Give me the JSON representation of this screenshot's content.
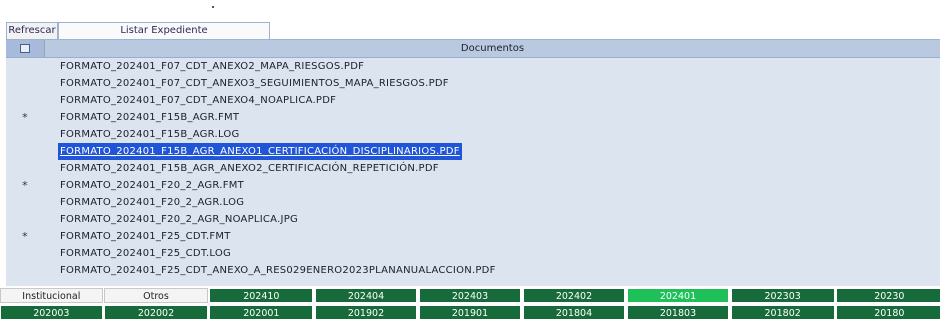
{
  "toolbar": {
    "refresh_label": "Refrescar",
    "list_label": "Listar Expediente"
  },
  "grid": {
    "header_title": "Documentos",
    "rows": [
      {
        "mark": "",
        "name": "FORMATO_202401_F07_CDT_ANEXO2_MAPA_RIESGOS.PDF"
      },
      {
        "mark": "",
        "name": "FORMATO_202401_F07_CDT_ANEXO3_SEGUIMIENTOS_MAPA_RIESGOS.PDF"
      },
      {
        "mark": "",
        "name": "FORMATO_202401_F07_CDT_ANEXO4_NOAPLICA.PDF"
      },
      {
        "mark": "*",
        "name": "FORMATO_202401_F15B_AGR.FMT"
      },
      {
        "mark": "",
        "name": "FORMATO_202401_F15B_AGR.LOG"
      },
      {
        "mark": "",
        "name": "FORMATO_202401_F15B_AGR_ANEXO1_CERTIFICACIÓN_DISCIPLINARIOS.PDF"
      },
      {
        "mark": "",
        "name": "FORMATO_202401_F15B_AGR_ANEXO2_CERTIFICACIÓN_REPETICIÓN.PDF"
      },
      {
        "mark": "*",
        "name": "FORMATO_202401_F20_2_AGR.FMT"
      },
      {
        "mark": "",
        "name": "FORMATO_202401_F20_2_AGR.LOG"
      },
      {
        "mark": "",
        "name": "FORMATO_202401_F20_2_AGR_NOAPLICA.JPG"
      },
      {
        "mark": "*",
        "name": "FORMATO_202401_F25_CDT.FMT"
      },
      {
        "mark": "",
        "name": "FORMATO_202401_F25_CDT.LOG"
      },
      {
        "mark": "",
        "name": "FORMATO_202401_F25_CDT_ANEXO_A_RES029ENERO2023PLANANUALACCION.PDF"
      }
    ],
    "selected_index": 5
  },
  "tabs_row1": [
    "Institucional",
    "Otros",
    "202410",
    "202404",
    "202403",
    "202402",
    "202401",
    "202303",
    "20230"
  ],
  "tabs_row2": [
    "202003",
    "202002",
    "202001",
    "201902",
    "201901",
    "201804",
    "201803",
    "201802",
    "20180"
  ],
  "active_tab": "202401",
  "colors": {
    "tab_dark": "#176b3a",
    "tab_active": "#1fc05a",
    "selection": "#1f55d6",
    "header": "#b9c9df"
  }
}
